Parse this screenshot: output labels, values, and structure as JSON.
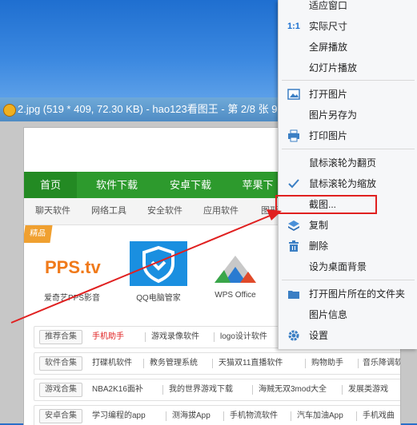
{
  "viewer": {
    "title": "2.jpg (519 * 409, 72.30 KB) - hao123看图王 - 第 2/8 张 9"
  },
  "page": {
    "nav_tabs": [
      "首页",
      "软件下载",
      "安卓下载",
      "苹果下"
    ],
    "sub_nav": [
      "聊天软件",
      "网络工具",
      "安全软件",
      "应用软件",
      "图形"
    ],
    "badge": "精品",
    "apps": [
      {
        "name": "爱奇艺PPS影音",
        "logo_text": "PPS.tv"
      },
      {
        "name": "QQ电脑管家",
        "logo_text": ""
      },
      {
        "name": "WPS Office",
        "logo_text": "WPS"
      }
    ],
    "rows": [
      {
        "tag": "推荐合集",
        "items": [
          "手机助手",
          "游戏录像软件",
          "logo设计软件"
        ]
      },
      {
        "tag": "软件合集",
        "items": [
          "打碟机软件",
          "教务管理系统",
          "天猫双11直播软件",
          "购物助手",
          "音乐降调软"
        ]
      },
      {
        "tag": "游戏合集",
        "items": [
          "NBA2K16面补",
          "我的世界游戏下载",
          "海贼无双3mod大全",
          "发展类游戏"
        ]
      },
      {
        "tag": "安卓合集",
        "items": [
          "学习编程的app",
          "测海拔App",
          "手机物流软件",
          "汽车加油App",
          "手机戏曲"
        ]
      }
    ]
  },
  "context_menu": {
    "items": [
      {
        "label": "适应窗口",
        "icon": ""
      },
      {
        "label": "实际尺寸",
        "icon": "1:1"
      },
      {
        "label": "全屏播放",
        "icon": ""
      },
      {
        "label": "幻灯片播放",
        "icon": ""
      },
      {
        "label": "打开图片",
        "icon": "image-icon"
      },
      {
        "label": "图片另存为",
        "icon": ""
      },
      {
        "label": "打印图片",
        "icon": "printer-icon"
      },
      {
        "label": "鼠标滚轮为翻页",
        "icon": ""
      },
      {
        "label": "鼠标滚轮为缩放",
        "icon": "checkmark-icon"
      },
      {
        "label": "截图...",
        "icon": ""
      },
      {
        "label": "复制",
        "icon": "copy-icon"
      },
      {
        "label": "删除",
        "icon": "trash-icon"
      },
      {
        "label": "设为桌面背景",
        "icon": ""
      },
      {
        "label": "打开图片所在的文件夹",
        "icon": "folder-icon"
      },
      {
        "label": "图片信息",
        "icon": ""
      },
      {
        "label": "设置",
        "icon": "gear-icon"
      }
    ],
    "shortcut_1to1": "1:1"
  },
  "colors": {
    "nav_green": "#2d9a2d",
    "highlight_red": "#e02020",
    "menu_bg": "#f6f7f9"
  }
}
